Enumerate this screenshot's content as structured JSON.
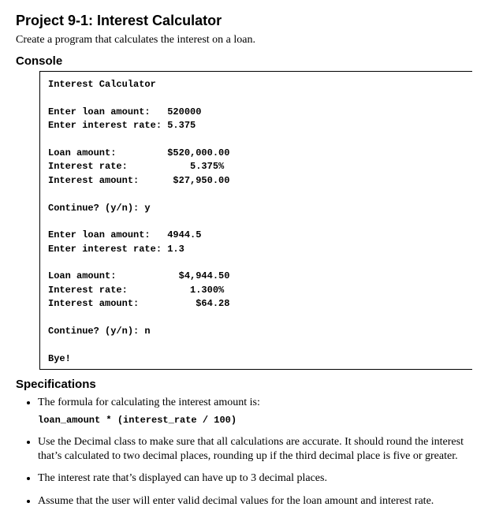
{
  "title": "Project 9-1: Interest Calculator",
  "intro": "Create a program that calculates the interest on a loan.",
  "console_heading": "Console",
  "console": {
    "header": "Interest Calculator",
    "run1": {
      "prompt_amount": "Enter loan amount:   520000",
      "prompt_rate": "Enter interest rate: 5.375",
      "out_amount": "Loan amount:         $520,000.00",
      "out_rate": "Interest rate:           5.375%",
      "out_interest": "Interest amount:      $27,950.00",
      "continue": "Continue? (y/n): y"
    },
    "run2": {
      "prompt_amount": "Enter loan amount:   4944.5",
      "prompt_rate": "Enter interest rate: 1.3",
      "out_amount": "Loan amount:           $4,944.50",
      "out_rate": "Interest rate:           1.300%",
      "out_interest": "Interest amount:          $64.28",
      "continue": "Continue? (y/n): n"
    },
    "bye": "Bye!"
  },
  "specs_heading": "Specifications",
  "specs": {
    "item1_text": "The formula for calculating the interest amount is:",
    "item1_formula": "loan_amount * (interest_rate / 100)",
    "item2": "Use the Decimal class to make sure that all calculations are accurate. It should round the interest that’s calculated to two decimal places, rounding up if the third decimal place is five or greater.",
    "item3": "The interest rate that’s displayed can have up to 3 decimal places.",
    "item4": "Assume that the user will enter valid decimal values for the loan amount and interest rate."
  }
}
